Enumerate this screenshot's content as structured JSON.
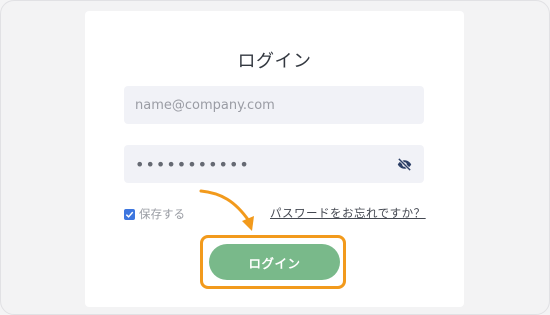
{
  "login_form": {
    "title": "ログイン",
    "email": {
      "value": "",
      "placeholder": "name@company.com"
    },
    "password": {
      "value": "•••••••••••",
      "toggle_icon": "eye-slash-icon"
    },
    "remember": {
      "label": "保存する",
      "checked": true
    },
    "forgot_link": "パスワードをお忘れですか？",
    "submit_label": "ログイン"
  },
  "annotation": {
    "highlight_color": "#f29a1c",
    "arrow_icon": "curved-arrow-icon"
  },
  "colors": {
    "button": "#79b98a",
    "checkbox": "#3d76df",
    "field_bg": "#f1f2f7"
  }
}
